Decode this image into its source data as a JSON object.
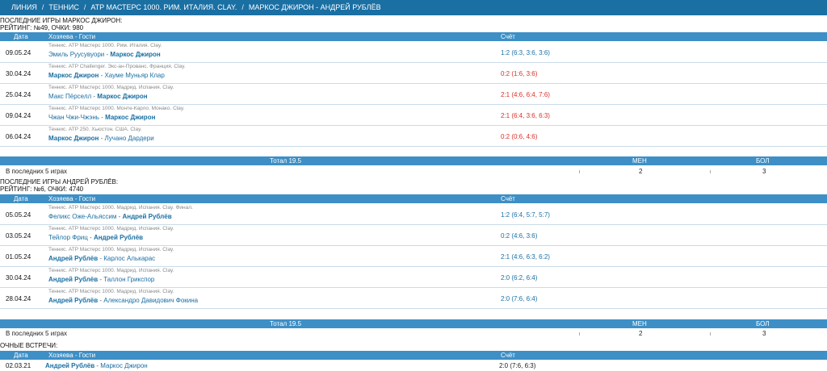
{
  "breadcrumb": [
    "ЛИНИЯ",
    "ТЕННИС",
    "ATP МАСТЕРС 1000. РИМ. ИТАЛИЯ. CLAY.",
    "МАРКОС ДЖИРОН - АНДРЕЙ РУБЛЁВ"
  ],
  "headers": {
    "date": "Дата",
    "teams": "Хозяева - Гости",
    "score": "Счёт"
  },
  "totals_headers": {
    "label": "Тотал 19.5",
    "under": "МЕН",
    "over": "БОЛ"
  },
  "colors": {
    "win": "#1a6fa3",
    "loss": "#d9302a",
    "header": "#3d8fc6",
    "topbar": "#1a6fa3"
  },
  "giron": {
    "title": "ПОСЛЕДНИЕ ИГРЫ МАРКОС ДЖИРОН:",
    "rating": "РЕЙТИНГ: №49, ОЧКИ: 980",
    "matches": [
      {
        "date": "09.05.24",
        "tournament": "Теннис. ATP Мастерс 1000. Рим. Италия. Clay.",
        "home": "Эмиль Руусувуори",
        "away": "Маркос Джирон",
        "score": "1:2 (6:3, 3:6, 3:6)",
        "result": "win"
      },
      {
        "date": "30.04.24",
        "tournament": "Теннис. ATP Challenger. Экс-ан-Прованс. Франция. Clay.",
        "home": "Маркос Джирон",
        "away": "Хауме Муньяр Клар",
        "score": "0:2 (1:6, 3:6)",
        "result": "loss"
      },
      {
        "date": "25.04.24",
        "tournament": "Теннис. ATP Мастерс 1000. Мадрид. Испания. Clay.",
        "home": "Макс Пёрселл",
        "away": "Маркос Джирон",
        "score": "2:1 (4:6, 6:4, 7:6)",
        "result": "loss"
      },
      {
        "date": "09.04.24",
        "tournament": "Теннис. ATP Мастерс 1000. Монте-Карло. Монако. Clay.",
        "home": "Чжан Чжи-Чжэнь",
        "away": "Маркос Джирон",
        "score": "2:1 (6:4, 3:6, 6:3)",
        "result": "loss"
      },
      {
        "date": "06.04.24",
        "tournament": "Теннис. ATP 250. Хьюстон. США. Clay.",
        "home": "Маркос Джирон",
        "away": "Лучано Дардери",
        "score": "0:2 (0:6, 4:6)",
        "result": "loss"
      }
    ],
    "totals": {
      "label": "В последних 5 играх",
      "under": "2",
      "over": "3"
    }
  },
  "rublev": {
    "title": "ПОСЛЕДНИЕ ИГРЫ АНДРЕЙ РУБЛЁВ:",
    "rating": "РЕЙТИНГ: №6, ОЧКИ: 4740",
    "matches": [
      {
        "date": "05.05.24",
        "tournament": "Теннис. ATP Мастерс 1000. Мадрид. Испания. Clay. Финал.",
        "home": "Феликс Оже-Альяссим",
        "away": "Андрей Рублёв",
        "score": "1:2 (6:4, 5:7, 5:7)",
        "result": "win"
      },
      {
        "date": "03.05.24",
        "tournament": "Теннис. ATP Мастерс 1000. Мадрид. Испания. Clay.",
        "home": "Тейлор Фриц",
        "away": "Андрей Рублёв",
        "score": "0:2 (4:6, 3:6)",
        "result": "win"
      },
      {
        "date": "01.05.24",
        "tournament": "Теннис. ATP Мастерс 1000. Мадрид. Испания. Clay.",
        "home": "Андрей Рублёв",
        "away": "Карлос Алькарас",
        "score": "2:1 (4:6, 6:3, 6:2)",
        "result": "win"
      },
      {
        "date": "30.04.24",
        "tournament": "Теннис. ATP Мастерс 1000. Мадрид. Испания. Clay.",
        "home": "Андрей Рублёв",
        "away": "Таллон Грикспор",
        "score": "2:0 (6:2, 6:4)",
        "result": "win"
      },
      {
        "date": "28.04.24",
        "tournament": "Теннис. ATP Мастерс 1000. Мадрид. Испания. Clay.",
        "home": "Андрей Рублёв",
        "away": "Александро Давидович Фокина",
        "score": "2:0 (7:6, 6:4)",
        "result": "win"
      }
    ],
    "totals": {
      "label": "В последних 5 играх",
      "under": "2",
      "over": "3"
    }
  },
  "h2h": {
    "title": "ОЧНЫЕ ВСТРЕЧИ:",
    "matches": [
      {
        "date": "02.03.21",
        "home": "Андрей Рублёв",
        "away": "Маркос Джирон",
        "score": "2:0 (7:6, 6:3)"
      }
    ]
  }
}
